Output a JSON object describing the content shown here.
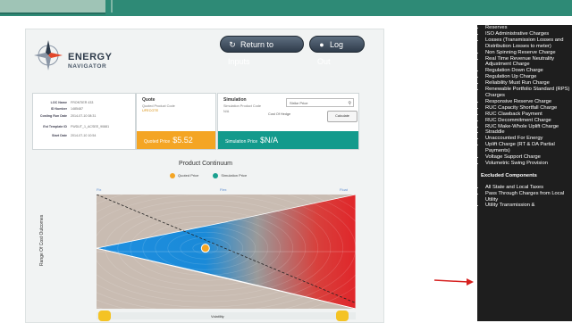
{
  "window": {
    "title": ""
  },
  "app": {
    "logo": {
      "line1": "ENERGY",
      "line2": "NAVIGATOR"
    },
    "buttons": {
      "return_label": "Return to Inputs",
      "logout_label": "Log Out"
    }
  },
  "info_card": {
    "rows": [
      {
        "key": "LOC Name",
        "value": "FRONTIER 433"
      },
      {
        "key": "ID Number",
        "value": "1485487"
      },
      {
        "key": "Costing Run Date",
        "value": "2014-07-10 08:31"
      },
      {
        "key": "Est Template ID",
        "value": "FWDUT_1_ACSEE_90881"
      },
      {
        "key": "Start Date",
        "value": "2014-07-10 10:54"
      }
    ]
  },
  "quote_card": {
    "title": "Quote",
    "product_code_label": "Quoted Product Code",
    "product_code_value": "UFECGTE",
    "price_label": "Quoted Price",
    "price_value": "$5.52"
  },
  "simulation_card": {
    "title": "Simulation",
    "product_code_label": "Simulation Product Code",
    "product_code_value": "N/A",
    "strike_placeholder": "Strike Price",
    "cost_of_hedge_label": "Cost Of Hedge",
    "calculate_label": "Calculate",
    "price_label": "Simulation Price",
    "price_value": "$N/A"
  },
  "chart_data": {
    "type": "area",
    "title": "Product Continuum",
    "ylabel": "Range Of Cost Outcomes",
    "xlabel": "Volatility",
    "legend": [
      {
        "name": "Quoted Price",
        "color": "#f4a524"
      },
      {
        "name": "Simulation Price",
        "color": "#1aa08f"
      }
    ],
    "x_ticks": [
      "Fix",
      "Flex",
      "Float"
    ],
    "x": [
      0,
      0.5,
      1
    ],
    "cone_lower": [
      0.53,
      0.27,
      0.0
    ],
    "cone_upper": [
      0.53,
      0.76,
      1.0
    ],
    "quoted_point": {
      "x": 0.42,
      "y": 0.53
    },
    "trend_line": {
      "start_y": 1.0,
      "end_y": 0.05
    },
    "volatility_colors": [
      "#1e8fe0",
      "#a0a0a0",
      "#e0262a"
    ]
  },
  "right_panel": {
    "included_items": [
      "Reserves",
      "ISO Administrative Charges",
      "Losses (Transmission Losses and Distribution Losses to meter)",
      "Non Spinning Reserve Charge",
      "Real Time Revenue Neutrality Adjustment Charge",
      "Regulation Down Charge",
      "Regulation Up Charge",
      "Reliability Must Run Charge",
      "Renewable Portfolio Standard (RPS) Charges",
      "Responsive Reserve Charge",
      "RUC Capacity Shortfall Charge",
      "RUC Clawback Payment",
      "RUC Decommitment Charge",
      "RUC Make-Whole Uplift Charge",
      "Straddle",
      "Unaccounted For Energy",
      "Uplift Charge (RT & DA Partial Payments)",
      "Voltage Support Charge",
      "Volumetric Swing Provision"
    ],
    "excluded_title": "Excluded Components",
    "excluded_items": [
      "All State and Local Taxes",
      "Pass Through Charges from Local Utility",
      "Utility Transmission &"
    ]
  },
  "colors": {
    "topbar": "#2e8a76",
    "quote_accent": "#f4a524",
    "simulation_accent": "#139a8c",
    "annotation_arrow": "#d6201f"
  }
}
